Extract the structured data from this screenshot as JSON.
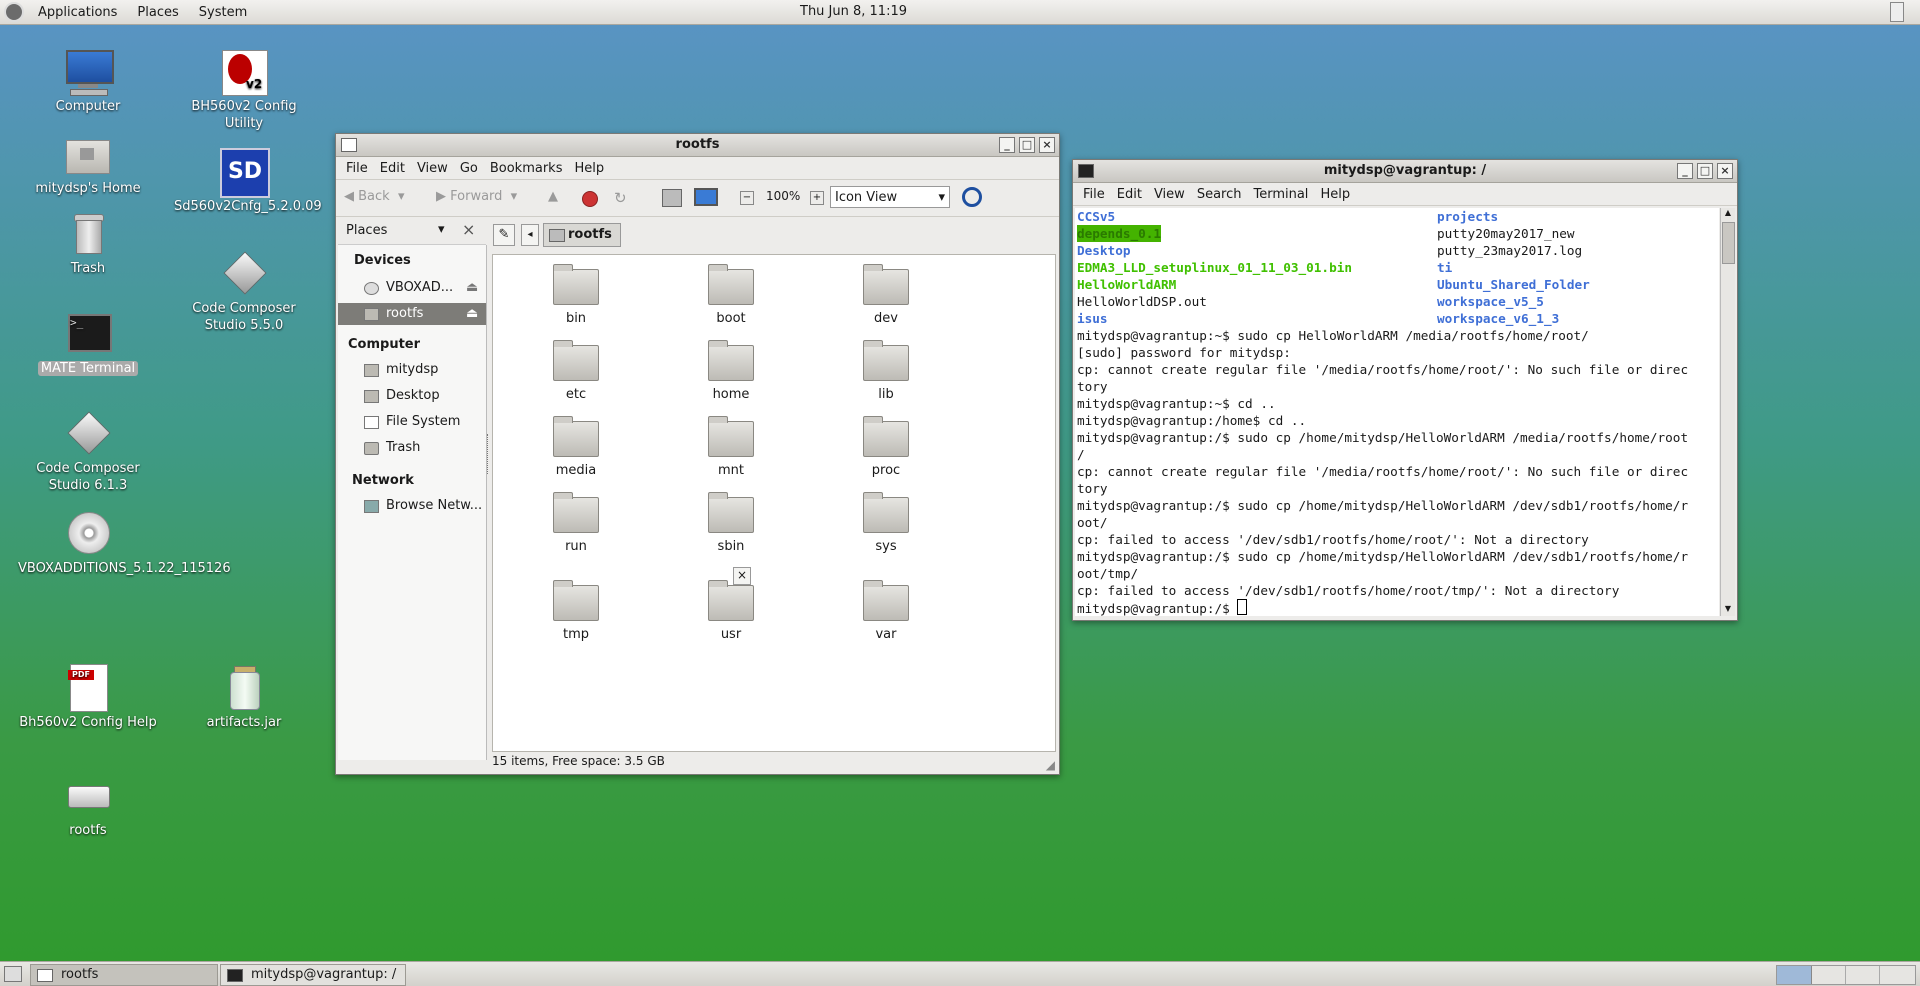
{
  "top_panel": {
    "menus": [
      "Applications",
      "Places",
      "System"
    ],
    "clock": "Thu Jun 8, 11:19"
  },
  "desktop": {
    "icons": [
      {
        "label": "Computer"
      },
      {
        "label": "mitydsp's Home"
      },
      {
        "label": "Trash"
      },
      {
        "label": "MATE Terminal"
      },
      {
        "label": "Code Composer Studio 6.1.3"
      },
      {
        "label": "VBOXADDITIONS_5.1.22_115126"
      },
      {
        "label": "Bh560v2 Config Help"
      },
      {
        "label": "rootfs"
      },
      {
        "label": "BH560v2 Config Utility"
      },
      {
        "label": "Sd560v2Cnfg_5.2.0.09"
      },
      {
        "label": "Code Composer Studio 5.5.0"
      },
      {
        "label": "artifacts.jar"
      }
    ]
  },
  "file_manager": {
    "title": "rootfs",
    "menus": [
      "File",
      "Edit",
      "View",
      "Go",
      "Bookmarks",
      "Help"
    ],
    "toolbar": {
      "back": "Back",
      "forward": "Forward",
      "zoom": "100%",
      "view_mode": "Icon View"
    },
    "sidebar": {
      "mode": "Places",
      "sections": {
        "devices": "Devices",
        "computer": "Computer",
        "network": "Network"
      },
      "devices": [
        "VBOXAD...",
        "rootfs"
      ],
      "computer": [
        "mitydsp",
        "Desktop",
        "File System",
        "Trash"
      ],
      "network": [
        "Browse Netw..."
      ]
    },
    "location": "rootfs",
    "folders": [
      "bin",
      "boot",
      "dev",
      "etc",
      "home",
      "lib",
      "media",
      "mnt",
      "proc",
      "run",
      "sbin",
      "sys",
      "tmp",
      "usr",
      "var"
    ],
    "status": "15 items, Free space: 3.5 GB"
  },
  "terminal": {
    "title": "mitydsp@vagrantup: /",
    "menus": [
      "File",
      "Edit",
      "View",
      "Search",
      "Terminal",
      "Help"
    ],
    "listing_left": [
      "CCSv5",
      "Desktop",
      "EDMA3_LLD_setuplinux_01_11_03_01.bin",
      "HelloWorldARM",
      "HelloWorldDSP.out",
      "isus"
    ],
    "listing_left_highlight": "depends_0.1",
    "listing_right": [
      "projects",
      "putty20may2017_new",
      "putty_23may2017.log",
      "ti",
      "Ubuntu_Shared_Folder",
      "workspace_v5_5",
      "workspace_v6_1_3"
    ],
    "lines": [
      "mitydsp@vagrantup:~$ sudo cp HelloWorldARM /media/rootfs/home/root/",
      "[sudo] password for mitydsp:",
      "cp: cannot create regular file '/media/rootfs/home/root/': No such file or direc",
      "tory",
      "mitydsp@vagrantup:~$ cd ..",
      "mitydsp@vagrantup:/home$ cd ..",
      "mitydsp@vagrantup:/$ sudo cp /home/mitydsp/HelloWorldARM /media/rootfs/home/root",
      "/",
      "cp: cannot create regular file '/media/rootfs/home/root/': No such file or direc",
      "tory",
      "mitydsp@vagrantup:/$ sudo cp /home/mitydsp/HelloWorldARM /dev/sdb1/rootfs/home/r",
      "oot/",
      "cp: failed to access '/dev/sdb1/rootfs/home/root/': Not a directory",
      "mitydsp@vagrantup:/$ sudo cp /home/mitydsp/HelloWorldARM /dev/sdb1/rootfs/home/r",
      "oot/tmp/",
      "cp: failed to access '/dev/sdb1/rootfs/home/root/tmp/': Not a directory"
    ],
    "prompt": "mitydsp@vagrantup:/$ "
  },
  "taskbar": {
    "items": [
      "rootfs",
      "mitydsp@vagrantup: /"
    ]
  }
}
